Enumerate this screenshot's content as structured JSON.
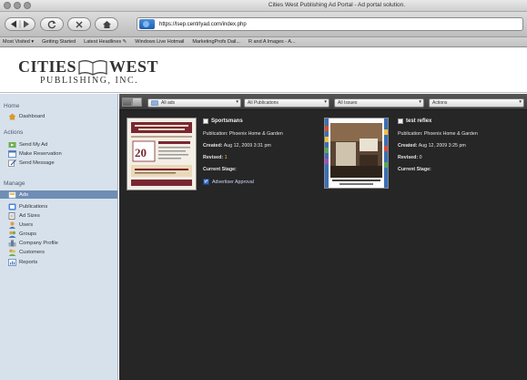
{
  "window": {
    "title": "Cities West Publishing Ad Portal - Ad portal solution."
  },
  "toolbar": {
    "url": "https://lsep.centrlyad.com/index.php"
  },
  "bookmarks": [
    "Most Visited ▾",
    "Getting Started",
    "Latest Headlines ✎",
    "Windows Live Hotmail",
    "MarketingProfs Dail...",
    "R and A Images - A..."
  ],
  "logo": {
    "line1a": "CITIES",
    "line1b": "WEST",
    "line2": "PUBLISHING, INC."
  },
  "sidebar": {
    "home_heading": "Home",
    "dashboard": "Dashboard",
    "actions_heading": "Actions",
    "send_ad": "Send My Ad",
    "make_reservation": "Make Reservation",
    "send_message": "Send Message",
    "manage_heading": "Manage",
    "manage_items": [
      "Ads",
      "Publications",
      "Ad Sizes",
      "Users",
      "Groups",
      "Company Profile",
      "Customers",
      "Reports"
    ],
    "selected_item": "Ads"
  },
  "filters": {
    "ads": "All ads",
    "publications": "All Publications",
    "issues": "All Issues",
    "actions": "Actions"
  },
  "cards": [
    {
      "title": "Sportsmans",
      "publication_label": "Publication:",
      "publication": "Phoenix Home & Garden",
      "created_label": "Created:",
      "created": "Aug 12, 2009 3:31 pm",
      "revised_label": "Revised:",
      "revised": "1",
      "stage_label": "Current Stage:",
      "approve_label": "Advertiser Approval",
      "thumb_caption": "20"
    },
    {
      "title": "test reflex",
      "publication_label": "Publication:",
      "publication": "Phoenix Home & Garden",
      "created_label": "Created:",
      "created": "Aug 12, 2009 3:25 pm",
      "revised_label": "Revised:",
      "revised": "0",
      "stage_label": "Current Stage:"
    }
  ],
  "colors": {
    "sidebar_bg": "#d7e1ec",
    "sidebar_selected": "#6f8db5",
    "content_bg": "#262626",
    "revised_highlight": "#f4c84a"
  }
}
